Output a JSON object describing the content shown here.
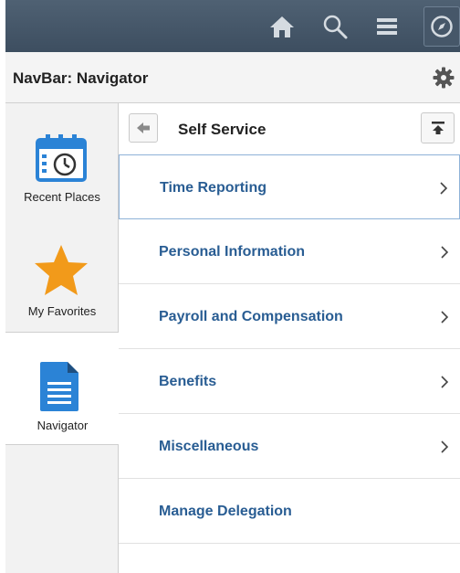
{
  "navbar": {
    "icons": [
      "home-icon",
      "search-icon",
      "menu-icon",
      "navigator-compass-icon"
    ]
  },
  "header": {
    "title": "NavBar: Navigator",
    "settings_icon": "gear-icon"
  },
  "tabs": [
    {
      "label": "Recent Places",
      "icon": "calendar-clock-icon"
    },
    {
      "label": "My Favorites",
      "icon": "star-icon"
    },
    {
      "label": "Navigator",
      "icon": "document-icon",
      "active": true
    }
  ],
  "panel": {
    "title": "Self Service",
    "back_icon": "back-arrow-icon",
    "top_icon": "scroll-top-icon"
  },
  "items": [
    {
      "label": "Time Reporting",
      "has_children": true,
      "selected": true
    },
    {
      "label": "Personal Information",
      "has_children": true
    },
    {
      "label": "Payroll and Compensation",
      "has_children": true
    },
    {
      "label": "Benefits",
      "has_children": true
    },
    {
      "label": "Miscellaneous",
      "has_children": true
    },
    {
      "label": "Manage Delegation",
      "has_children": false
    }
  ],
  "colors": {
    "accent_link": "#295d93",
    "topbar": "#45576a",
    "star": "#f29a1a",
    "icon_blue": "#2b83d6"
  }
}
